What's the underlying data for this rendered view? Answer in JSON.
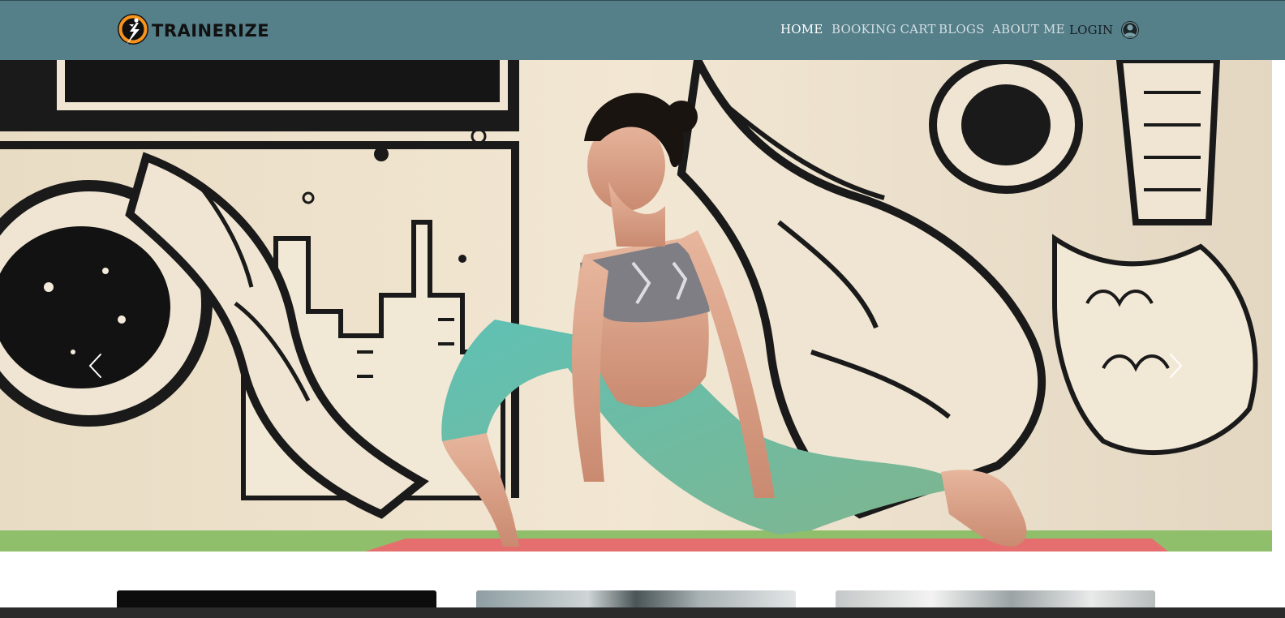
{
  "header": {
    "brand": {
      "name": "TRAINERIZE",
      "logo_icon": "lightning-runner-logo-icon"
    },
    "nav": {
      "home": "HOME",
      "booking_cart": "BOOKING CART",
      "blogs": "BLOGS",
      "about_me": "ABOUT ME",
      "login": "LOGIN",
      "login_icon": "user-circle-icon"
    },
    "active_item": "HOME"
  },
  "carousel": {
    "prev_icon": "chevron-left-icon",
    "next_icon": "chevron-right-icon"
  },
  "colors": {
    "header_bg": "#557f89",
    "nav_text": "#d4dfe2",
    "nav_active": "#ffffff",
    "accent_orange": "#f7941d"
  }
}
